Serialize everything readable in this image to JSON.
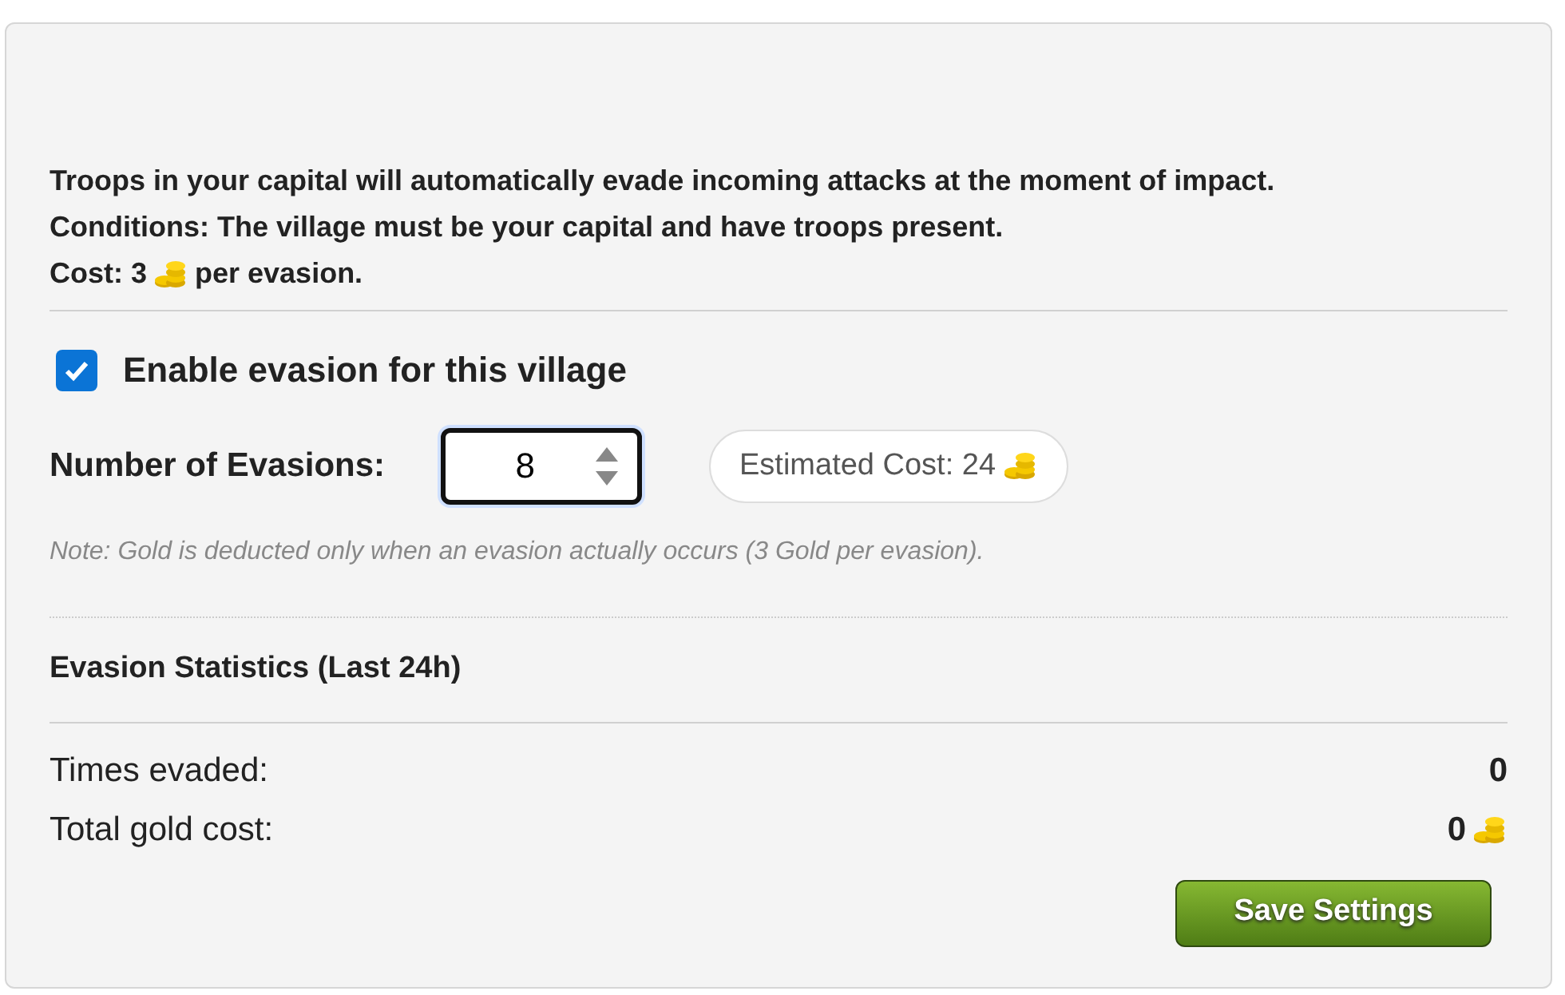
{
  "intro": {
    "lines": [
      "Troops in your capital will automatically evade incoming attacks at the moment of impact.",
      "Conditions: The village must be your capital and have troops present."
    ],
    "cost_prefix": "Cost: 3",
    "cost_suffix": "per evasion."
  },
  "enable": {
    "label": "Enable evasion for this village",
    "checked": true
  },
  "evasions": {
    "label": "Number of Evasions:",
    "value": "8"
  },
  "estimate": "Estimated Cost: 24",
  "note": "Note: Gold is deducted only when an evasion actually occurs (3 Gold per evasion).",
  "stats": {
    "title": "Evasion Statistics (Last 24h)",
    "rows": [
      {
        "label": "Times evaded:",
        "value": "0",
        "coins": false
      },
      {
        "label": "Total gold cost:",
        "value": "0",
        "coins": true
      }
    ]
  },
  "save_button": "Save Settings"
}
